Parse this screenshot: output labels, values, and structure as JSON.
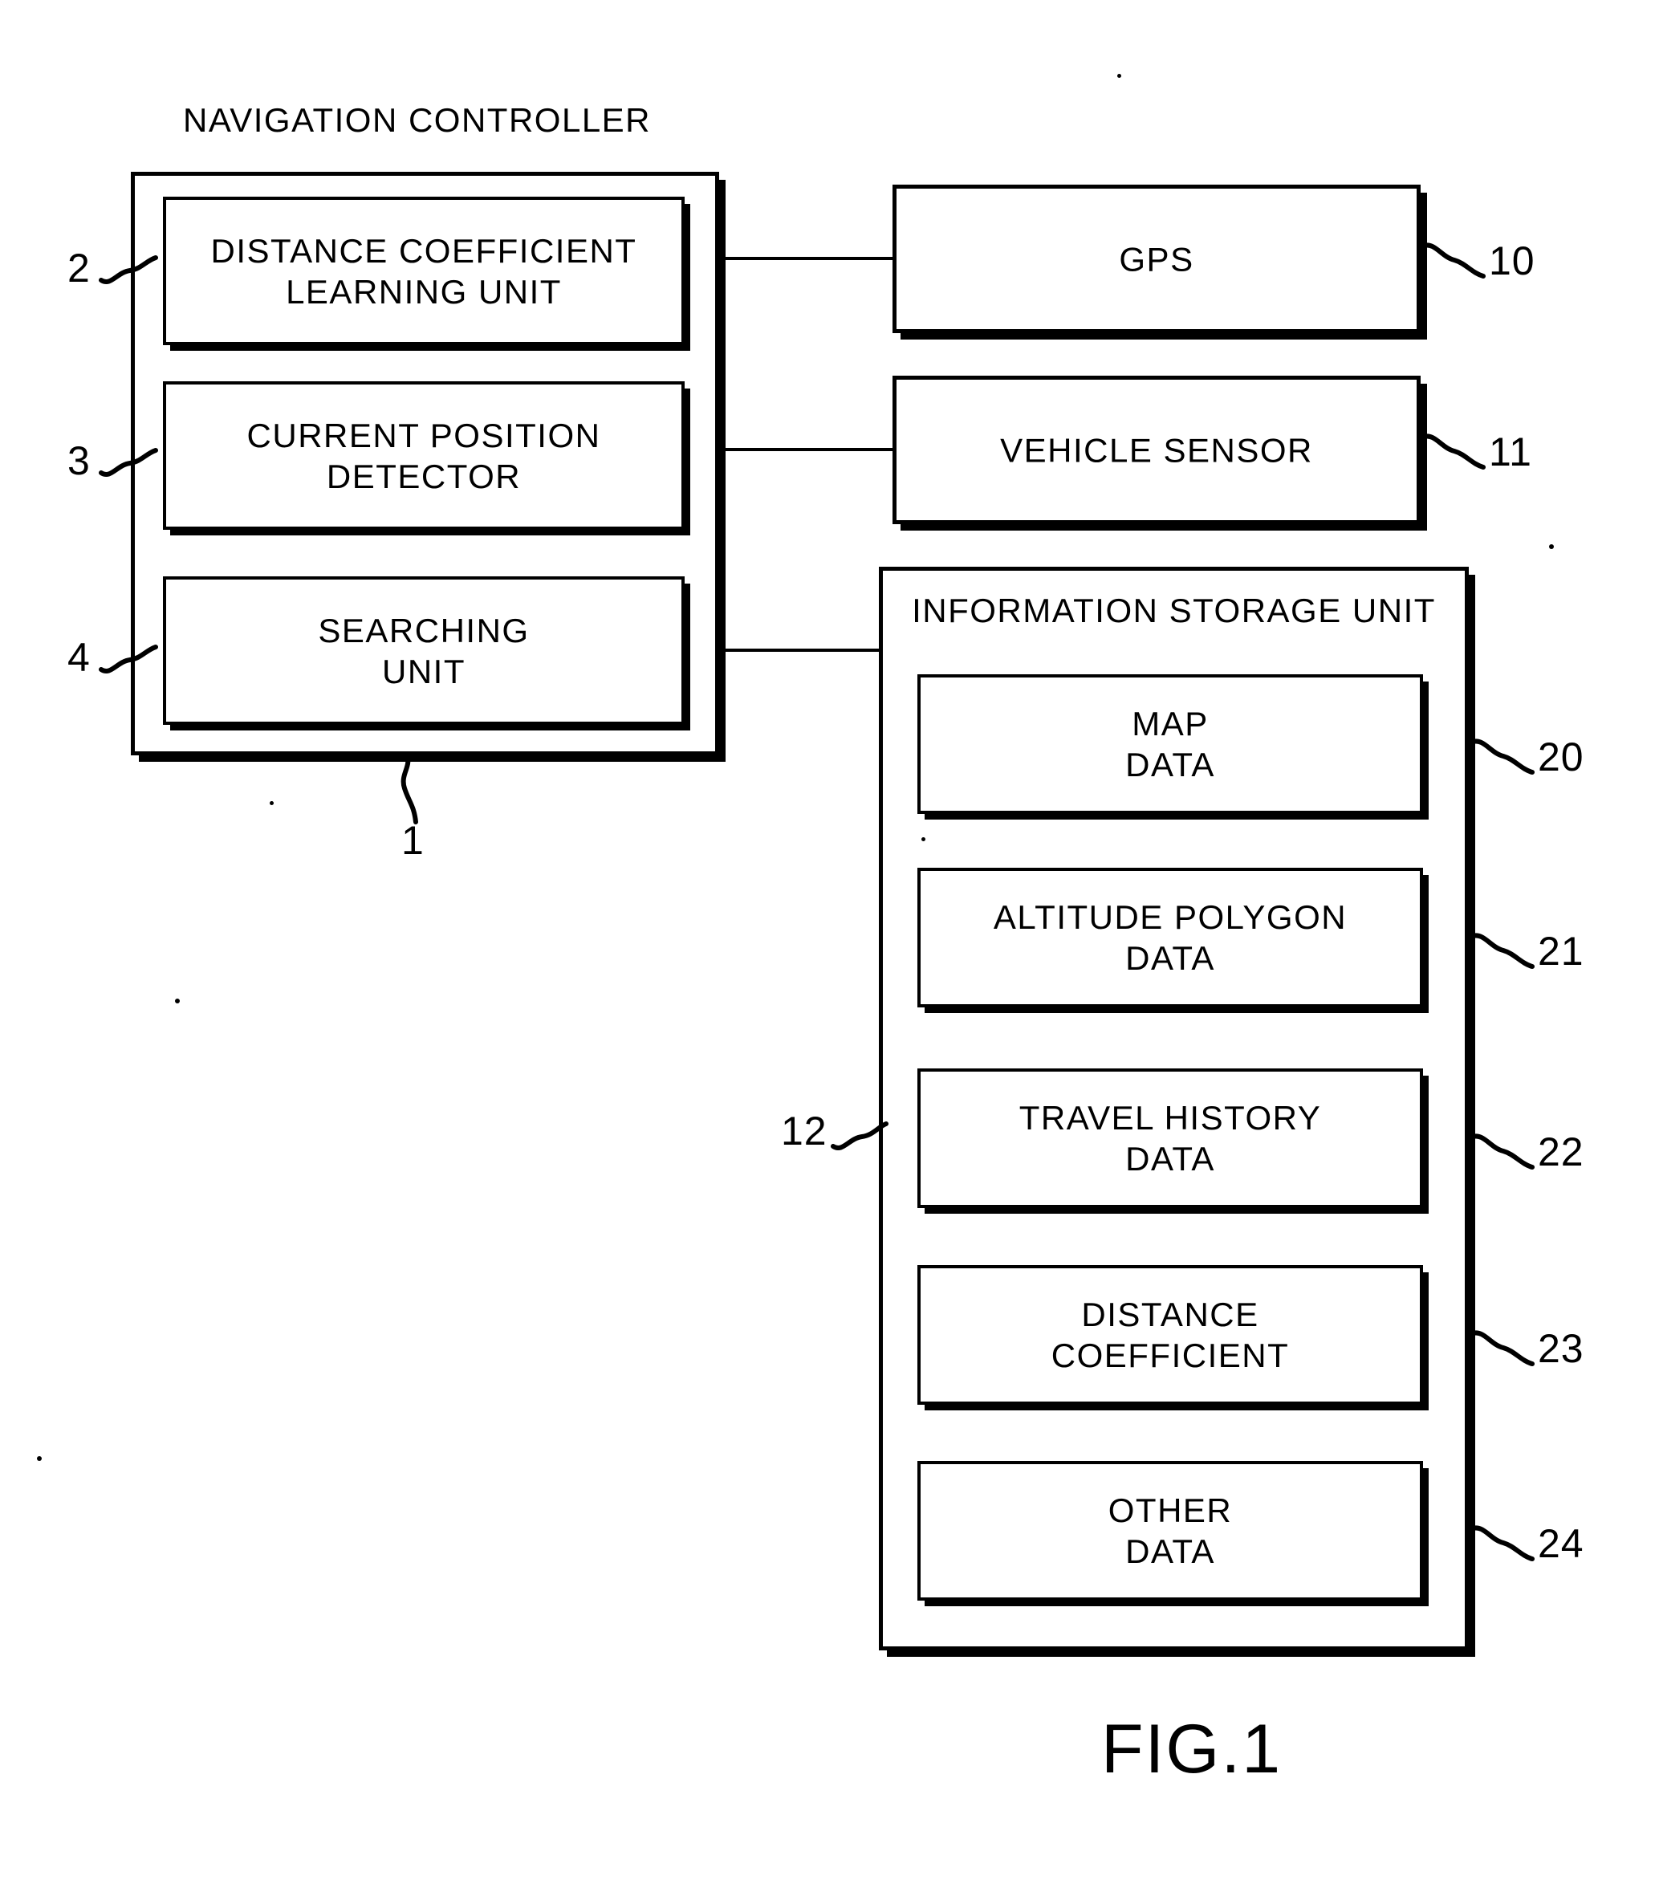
{
  "figure": {
    "number": "FIG.1",
    "title": "NAVIGATION  CONTROLLER"
  },
  "navigation_controller": {
    "title": "NAVIGATION  CONTROLLER",
    "ref": "1",
    "units": [
      {
        "label": "DISTANCE  COEFFICIENT\nLEARNING  UNIT",
        "ref": "2"
      },
      {
        "label": "CURRENT  POSITION\nDETECTOR",
        "ref": "3"
      },
      {
        "label": "SEARCHING\nUNIT",
        "ref": "4"
      }
    ]
  },
  "peripherals": [
    {
      "label": "GPS",
      "ref": "10"
    },
    {
      "label": "VEHICLE  SENSOR",
      "ref": "11"
    }
  ],
  "information_storage_unit": {
    "title": "INFORMATION  STORAGE  UNIT",
    "ref": "12",
    "data_blocks": [
      {
        "label": "MAP\nDATA",
        "ref": "20"
      },
      {
        "label": "ALTITUDE  POLYGON\nDATA",
        "ref": "21"
      },
      {
        "label": "TRAVEL  HISTORY\nDATA",
        "ref": "22"
      },
      {
        "label": "DISTANCE\nCOEFFICIENT",
        "ref": "23"
      },
      {
        "label": "OTHER\nDATA",
        "ref": "24"
      }
    ]
  },
  "colors": {
    "ink": "#000000",
    "paper": "#ffffff"
  }
}
